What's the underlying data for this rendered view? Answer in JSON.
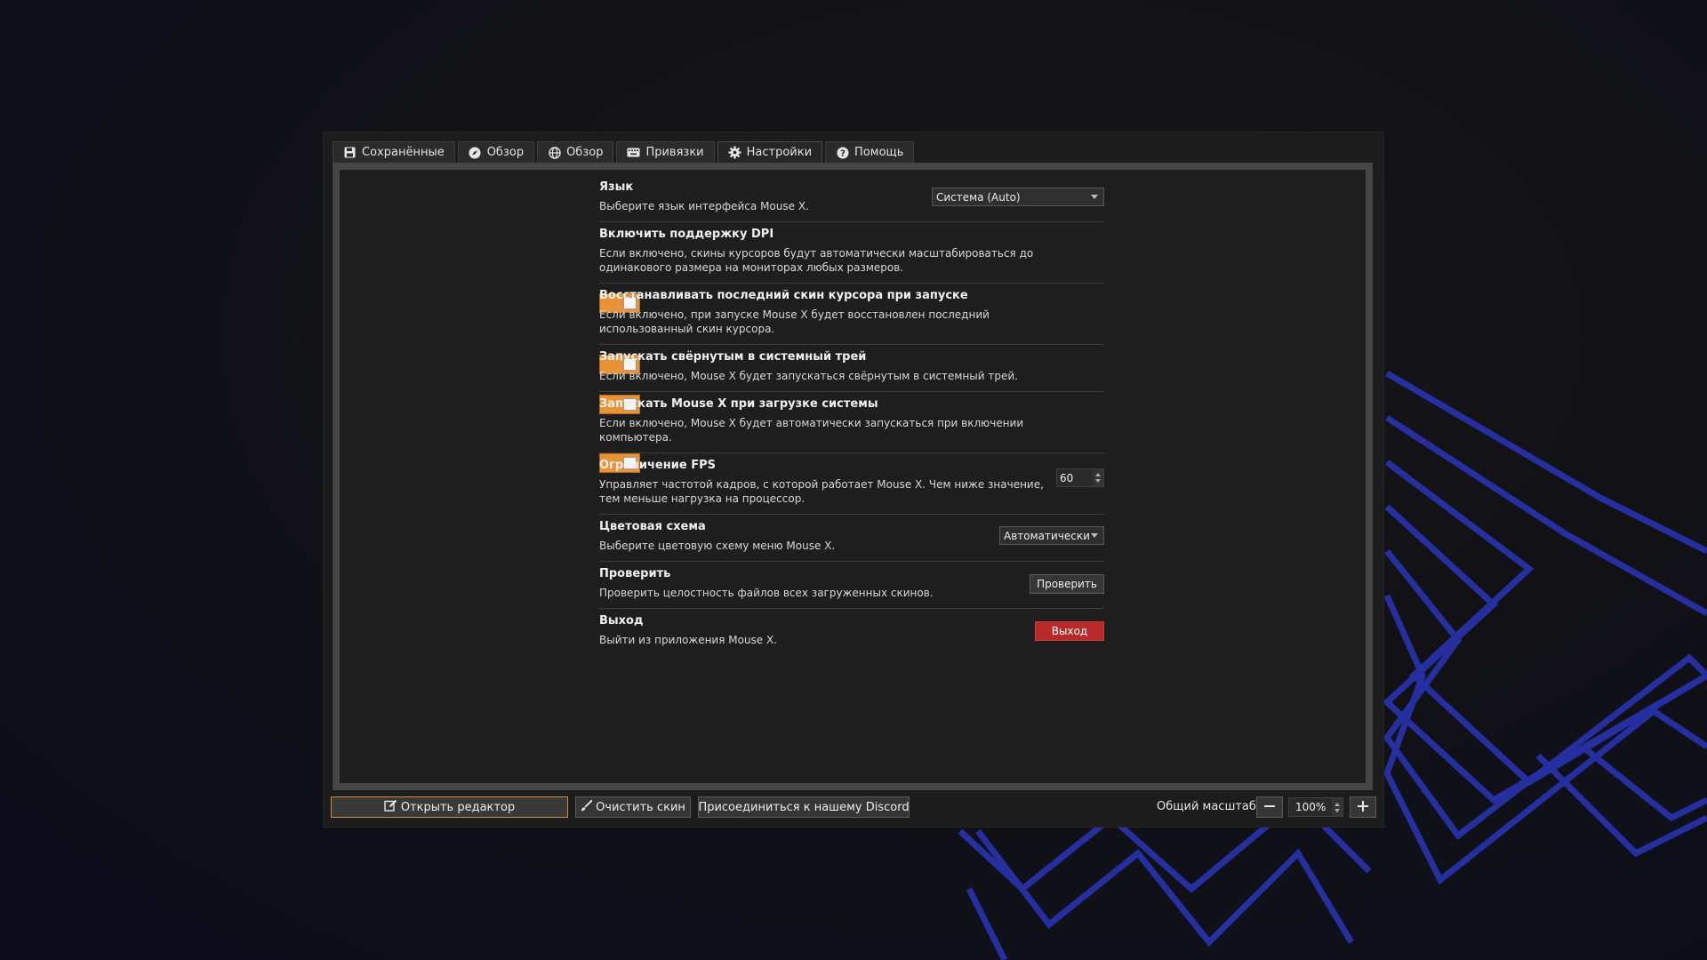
{
  "tabs": [
    {
      "label": "Сохранённые",
      "icon": "save-icon"
    },
    {
      "label": "Обзор",
      "icon": "compass-icon"
    },
    {
      "label": "Обзор",
      "icon": "globe-icon"
    },
    {
      "label": "Привязки",
      "icon": "keyboard-icon"
    },
    {
      "label": "Настройки",
      "icon": "gear-icon",
      "active": true
    },
    {
      "label": "Помощь",
      "icon": "help-icon"
    }
  ],
  "settings": {
    "language": {
      "title": "Язык",
      "desc": "Выберите язык интерфейса Mouse X.",
      "value": "Система (Auto)"
    },
    "dpi": {
      "title": "Включить поддержку DPI",
      "desc": "Если включено, скины курсоров будут автоматически масштабироваться до одинакового размера на мониторах любых размеров.",
      "enabled": true
    },
    "restore_skin": {
      "title": "Восстанавливать последний скин курсора при запуске",
      "desc": "Если включено, при запуске Mouse X будет восстановлен последний использованный скин курсора.",
      "enabled": true
    },
    "start_minimized": {
      "title": "Запускать свёрнутым в системный трей",
      "desc": "Если включено, Mouse X будет запускаться свёрнутым в системный трей.",
      "enabled": true
    },
    "autostart": {
      "title": "Запускать Mouse X при загрузке системы",
      "desc": "Если включено, Mouse X будет автоматически запускаться при включении компьютера.",
      "enabled": true
    },
    "fps": {
      "title": "Ограничение FPS",
      "desc": "Управляет частотой кадров, с которой работает Mouse X. Чем ниже значение, тем меньше нагрузка на процессор.",
      "value": "60"
    },
    "color_scheme": {
      "title": "Цветовая схема",
      "desc": "Выберите цветовую схему меню Mouse X.",
      "value": "Автоматически"
    },
    "verify": {
      "title": "Проверить",
      "desc": "Проверить целостность файлов всех загруженных скинов.",
      "button": "Проверить"
    },
    "exit": {
      "title": "Выход",
      "desc": "Выйти из приложения Mouse X.",
      "button": "Выход"
    }
  },
  "footer": {
    "open_editor": "Открыть редактор",
    "clear_skin": "Очистить скин",
    "discord": "Присоединиться к нашему Discord",
    "scale_label": "Общий масштаб:",
    "scale_value": "100%"
  },
  "colors": {
    "accent": "#e89338",
    "danger": "#b82a2a",
    "lines": "#2a35b8"
  }
}
